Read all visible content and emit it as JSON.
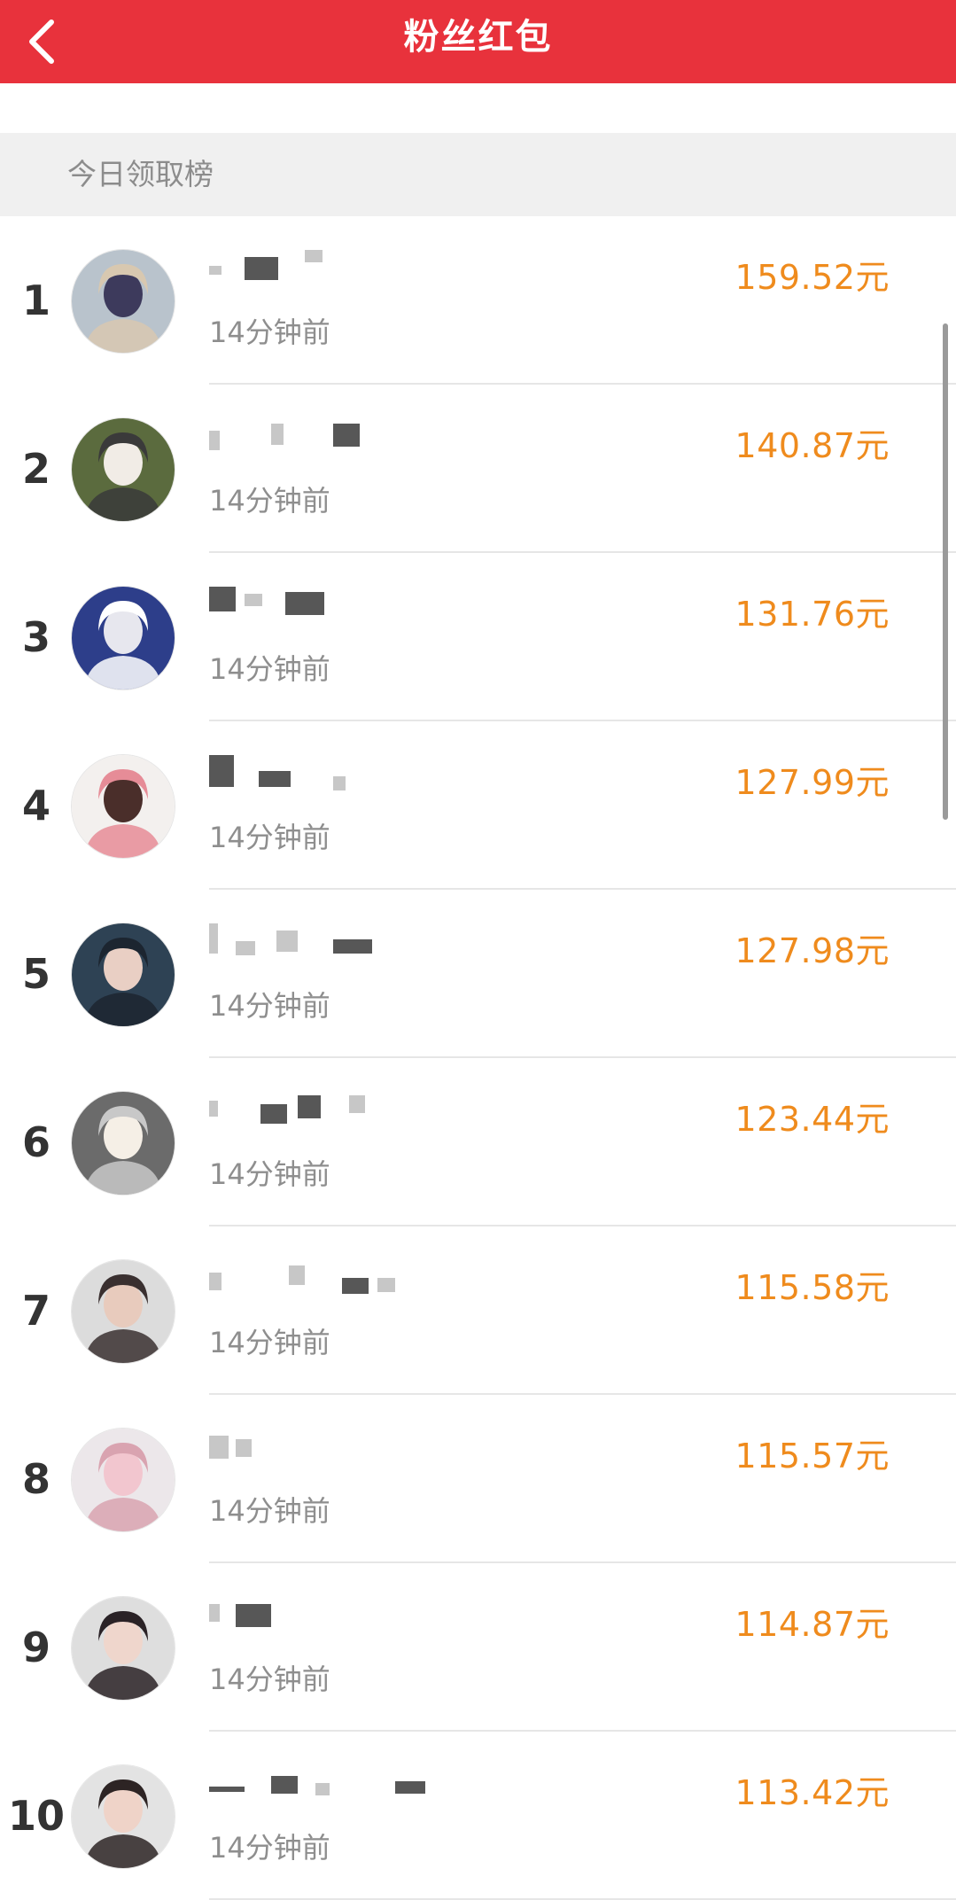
{
  "header": {
    "title": "粉丝红包"
  },
  "section": {
    "title": "今日领取榜"
  },
  "colors": {
    "header_bg": "#e8323c",
    "amount": "#ef8b1d",
    "section_bg": "#f0f0f0"
  },
  "list": [
    {
      "rank": "1",
      "time": "14分钟前",
      "amount": "159.52元",
      "avatar": {
        "bg": "#b9c3cc",
        "fg": "#3d3a5c",
        "accent": "#d8c8b0"
      }
    },
    {
      "rank": "2",
      "time": "14分钟前",
      "amount": "140.87元",
      "avatar": {
        "bg": "#5b6b3e",
        "fg": "#f1ece6",
        "accent": "#3a3a3a"
      }
    },
    {
      "rank": "3",
      "time": "14分钟前",
      "amount": "131.76元",
      "avatar": {
        "bg": "#2d3e8a",
        "fg": "#e7e7ee",
        "accent": "#ffffff"
      }
    },
    {
      "rank": "4",
      "time": "14分钟前",
      "amount": "127.99元",
      "avatar": {
        "bg": "#f3f0ee",
        "fg": "#4a2e2a",
        "accent": "#e68c97"
      }
    },
    {
      "rank": "5",
      "time": "14分钟前",
      "amount": "127.98元",
      "avatar": {
        "bg": "#2e4254",
        "fg": "#e9cfc4",
        "accent": "#1c2530"
      }
    },
    {
      "rank": "6",
      "time": "14分钟前",
      "amount": "123.44元",
      "avatar": {
        "bg": "#6b6b6b",
        "fg": "#f5efe6",
        "accent": "#c8c8c8"
      }
    },
    {
      "rank": "7",
      "time": "14分钟前",
      "amount": "115.58元",
      "avatar": {
        "bg": "#dcdcdc",
        "fg": "#e8cbbd",
        "accent": "#3a3030"
      }
    },
    {
      "rank": "8",
      "time": "14分钟前",
      "amount": "115.57元",
      "avatar": {
        "bg": "#ece7ea",
        "fg": "#f2c6cf",
        "accent": "#d9a3b0"
      }
    },
    {
      "rank": "9",
      "time": "14分钟前",
      "amount": "114.87元",
      "avatar": {
        "bg": "#dedede",
        "fg": "#efd6cc",
        "accent": "#2a2226"
      }
    },
    {
      "rank": "10",
      "time": "14分钟前",
      "amount": "113.42元",
      "avatar": {
        "bg": "#e3e3e3",
        "fg": "#efd3c8",
        "accent": "#2d2424"
      }
    }
  ]
}
